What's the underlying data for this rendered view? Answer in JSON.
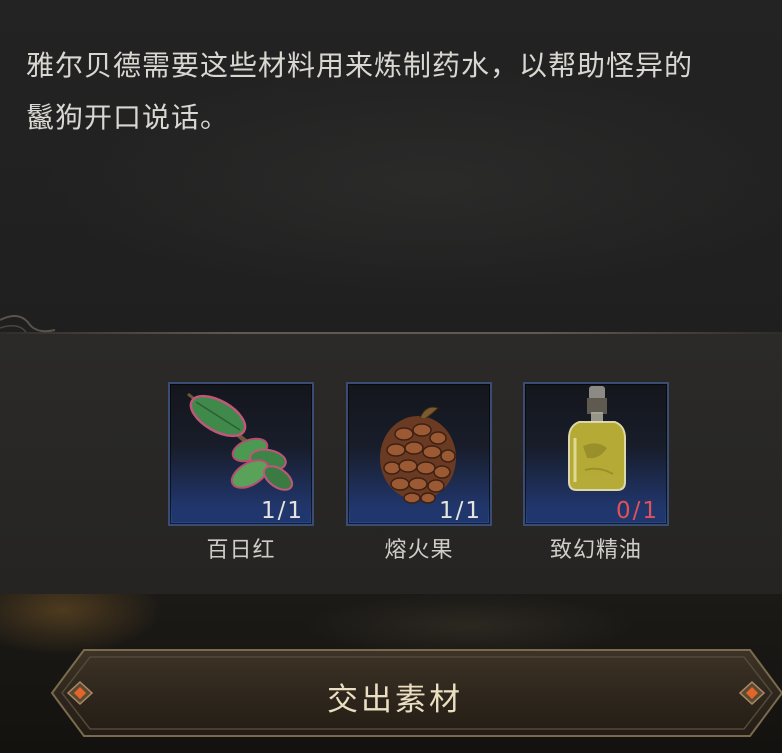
{
  "dialog": {
    "lines": [
      "雅尔贝德需要这些材料用来炼制药水，以帮助怪异的",
      "鬣狗开口说话。"
    ]
  },
  "materials": [
    {
      "name": "百日红",
      "have": "1",
      "need": "1",
      "icon": "leaf-icon",
      "sufficient": true
    },
    {
      "name": "熔火果",
      "have": "1",
      "need": "1",
      "icon": "pinecone-fruit-icon",
      "sufficient": true
    },
    {
      "name": "致幻精油",
      "have": "0",
      "need": "1",
      "icon": "oil-bottle-icon",
      "sufficient": false
    }
  ],
  "submit_button": {
    "label": "交出素材"
  },
  "colors": {
    "insufficient": "#e0515a",
    "count": "#e7e4dd",
    "slot_border": "#3b4c72"
  }
}
